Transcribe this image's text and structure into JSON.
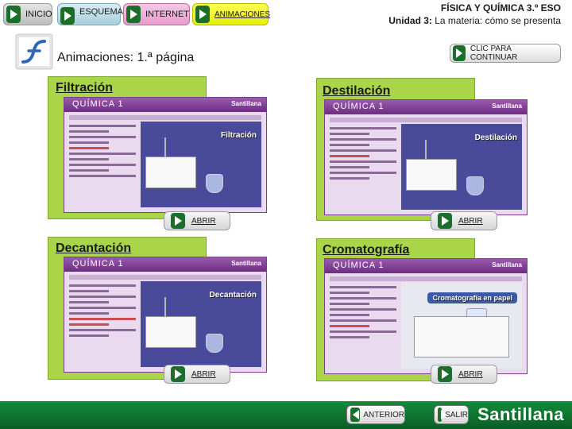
{
  "nav": {
    "home_label": "INICIO",
    "scheme_label": "ESQUEMA",
    "internet_label": "INTERNET",
    "animations_label": "ANIMACIONES"
  },
  "course": {
    "title": "FÍSICA Y QUÍMICA 3.º ESO",
    "unit_prefix": "Unidad 3:",
    "unit_name": " La materia: cómo se presenta"
  },
  "page": {
    "heading": "Animaciones: 1.ª página",
    "continue_label": "CLIC PARA CONTINUAR"
  },
  "cards": [
    {
      "title": "Filtración",
      "thumb_brand": "QUÍMICA 1",
      "thumb_publisher": "Santillana",
      "thumb_sim_title": "Filtración",
      "open_label": "ABRIR"
    },
    {
      "title": "Destilación",
      "thumb_brand": "QUÍMICA 1",
      "thumb_publisher": "Santillana",
      "thumb_sim_title": "Destilación",
      "open_label": "ABRIR"
    },
    {
      "title": "Decantación",
      "thumb_brand": "QUÍMICA 1",
      "thumb_publisher": "Santillana",
      "thumb_sim_title": "Decantación",
      "open_label": "ABRIR"
    },
    {
      "title": "Cromatografía",
      "thumb_brand": "QUÍMICA 1",
      "thumb_publisher": "Santillana",
      "thumb_sim_title": "Cromatografía en papel",
      "open_label": "ABRIR"
    }
  ],
  "footer": {
    "back_label": "ANTERIOR",
    "exit_label": "SALIR",
    "brand": "Santillana"
  },
  "colors": {
    "panel_green": "#abd548",
    "footer_green": "#128a3b",
    "play_green": "#1d6e2a",
    "thumb_purple": "#7b3e8e"
  },
  "icons": [
    "play-icon",
    "back-icon",
    "flash-logo-icon"
  ]
}
